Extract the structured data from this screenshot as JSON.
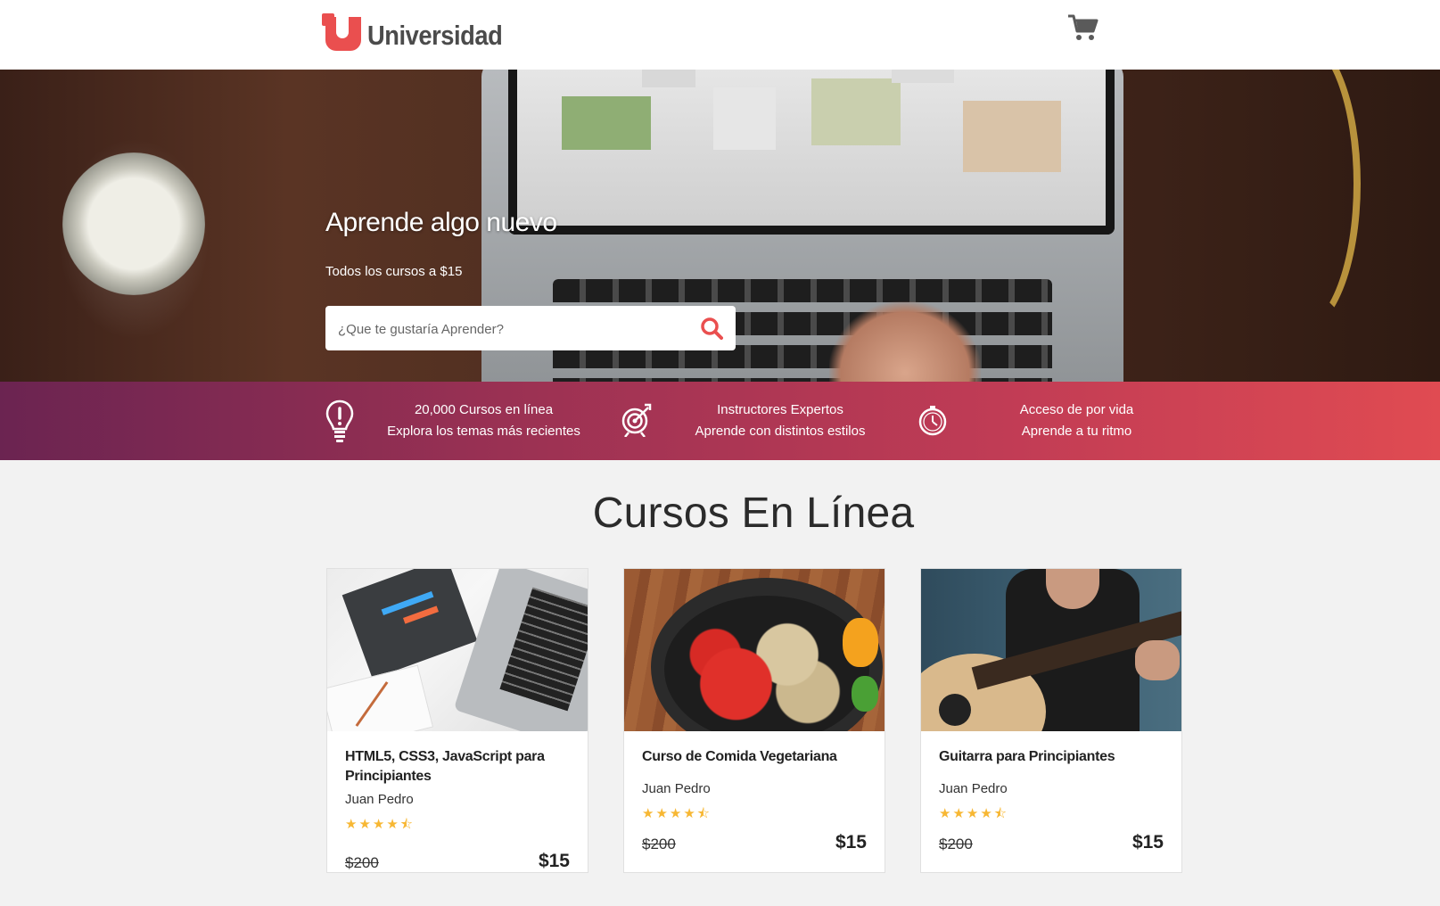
{
  "header": {
    "logo_text": "Universidad",
    "cart_icon": "shopping-cart-icon"
  },
  "hero": {
    "title": "Aprende algo nuevo",
    "subtitle": "Todos los cursos a $15",
    "search_placeholder": "¿Que te gustaría Aprender?",
    "search_icon": "search-icon"
  },
  "features": [
    {
      "icon": "lightbulb-icon",
      "line1": "20,000 Cursos en línea",
      "line2": "Explora los temas más recientes"
    },
    {
      "icon": "target-icon",
      "line1": "Instructores Expertos",
      "line2": "Aprende con distintos estilos"
    },
    {
      "icon": "clock-icon",
      "line1": "Acceso de por vida",
      "line2": "Aprende a tu ritmo"
    }
  ],
  "courses_section": {
    "title": "Cursos En Línea",
    "courses": [
      {
        "title": "HTML5, CSS3, JavaScript para Principiantes",
        "author": "Juan Pedro",
        "rating": 4.5,
        "stars": "★★★★⯪",
        "old_price": "$200",
        "price": "$15"
      },
      {
        "title": "Curso de Comida Vegetariana",
        "author": "Juan Pedro",
        "rating": 4.5,
        "stars": "★★★★⯪",
        "old_price": "$200",
        "price": "$15"
      },
      {
        "title": "Guitarra para Principiantes",
        "author": "Juan Pedro",
        "rating": 4.5,
        "stars": "★★★★⯪",
        "old_price": "$200",
        "price": "$15"
      }
    ]
  },
  "colors": {
    "brand": "#ea4f4f",
    "bar_start": "#6b2451",
    "bar_end": "#e04b52",
    "star": "#f7b733"
  }
}
